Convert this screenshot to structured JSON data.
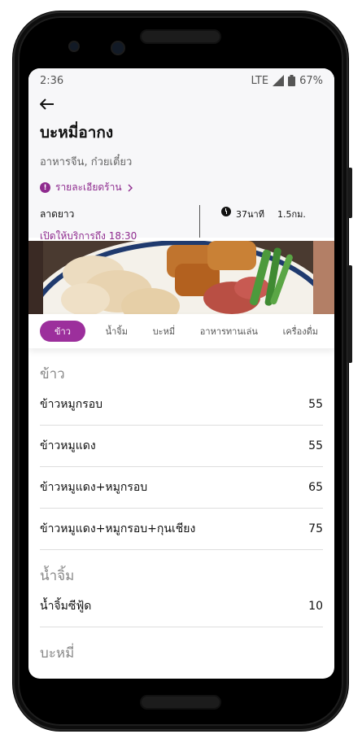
{
  "status_bar": {
    "time": "2:36",
    "network": "LTE",
    "battery": "67%"
  },
  "restaurant": {
    "name": "บะหมี่อากง",
    "categories": "อาหารจีน, ก๋วยเตี๋ยว",
    "details_link": "รายละเอียดร้าน",
    "branch": "ลาดยาว",
    "open_until": "เปิดให้บริการถึง 18:30",
    "delivery_time": "37นาที",
    "distance": "1.5กม."
  },
  "tabs": [
    {
      "label": "ข้าว",
      "active": true
    },
    {
      "label": "น้ำจิ้ม",
      "active": false
    },
    {
      "label": "บะหมี่",
      "active": false
    },
    {
      "label": "อาหารทานเล่น",
      "active": false
    },
    {
      "label": "เครื่องดื่ม",
      "active": false
    }
  ],
  "menu": {
    "rice": {
      "title": "ข้าว",
      "items": [
        {
          "name": "ข้าวหมูกรอบ",
          "price": "55"
        },
        {
          "name": "ข้าวหมูแดง",
          "price": "55"
        },
        {
          "name": "ข้าวหมูแดง+หมูกรอบ",
          "price": "65"
        },
        {
          "name": "ข้าวหมูแดง+หมูกรอบ+กุนเชียง",
          "price": "75"
        }
      ]
    },
    "sauce": {
      "title": "น้ำจิ้ม",
      "items": [
        {
          "name": "น้ำจิ้มซีฟู้ด",
          "price": "10"
        }
      ]
    },
    "noodle": {
      "title": "บะหมี่"
    }
  },
  "colors": {
    "accent": "#9c2f9c"
  },
  "icons": {
    "back": "arrow-left-icon",
    "info": "info-icon",
    "chevron": "chevron-right-icon",
    "clock": "clock-icon"
  }
}
